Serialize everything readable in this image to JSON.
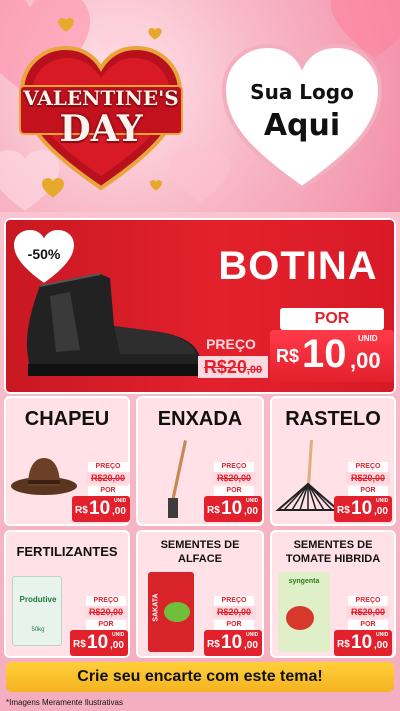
{
  "header": {
    "badge_line1": "VALENTINE'S",
    "badge_line2": "DAY",
    "logo_line1": "Sua Logo",
    "logo_line2": "Aqui"
  },
  "featured": {
    "discount": "-50%",
    "title": "BOTINA",
    "old_label": "PREÇO",
    "old_price_int": "R$20",
    "old_price_dec": ",00",
    "por_label": "POR",
    "new_rs": "R$",
    "new_int": "10",
    "new_dec": ",00",
    "unid": "UNID"
  },
  "products": [
    {
      "title": "CHAPEU",
      "old_label": "PREÇO",
      "old_price": "R$20,00",
      "por_label": "POR",
      "rs": "R$",
      "int": "10",
      "dec": ",00",
      "unid": "UNID"
    },
    {
      "title": "ENXADA",
      "old_label": "PREÇO",
      "old_price": "R$20,00",
      "por_label": "POR",
      "rs": "R$",
      "int": "10",
      "dec": ",00",
      "unid": "UNID"
    },
    {
      "title": "RASTELO",
      "old_label": "PREÇO",
      "old_price": "R$20,00",
      "por_label": "POR",
      "rs": "R$",
      "int": "10",
      "dec": ",00",
      "unid": "UNID"
    },
    {
      "title": "FERTILIZANTES",
      "old_label": "PREÇO",
      "old_price": "R$20,00",
      "por_label": "POR",
      "rs": "R$",
      "int": "10",
      "dec": ",00",
      "unid": "UNID",
      "pack_brand": "Produtive",
      "pack_weight": "50kg"
    },
    {
      "title": "SEMENTES DE ALFACE",
      "old_label": "PREÇO",
      "old_price": "R$20,00",
      "por_label": "POR",
      "rs": "R$",
      "int": "10",
      "dec": ",00",
      "unid": "UNID",
      "pack_brand": "SAKATA"
    },
    {
      "title": "SEMENTES DE TOMATE HIBRIDA",
      "old_label": "PREÇO",
      "old_price": "R$20,00",
      "por_label": "POR",
      "rs": "R$",
      "int": "10",
      "dec": ",00",
      "unid": "UNID",
      "pack_brand": "syngenta"
    }
  ],
  "cta": "Crie seu encarte com este tema!",
  "footnote": "*Imagens Meramente Ilustrativas",
  "colors": {
    "red": "#e3212d",
    "pink": "#f7b6c6",
    "gold": "#f5b320"
  }
}
